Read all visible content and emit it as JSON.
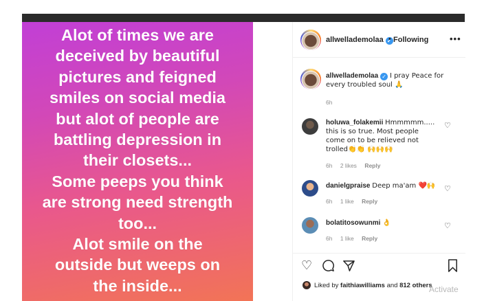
{
  "post_image": {
    "lines": [
      "Alot of times we are",
      "deceived by beautiful",
      "pictures and feigned",
      "smiles on social media",
      "but alot of people are",
      "battling depression in",
      "their closets...",
      "Some peeps you think",
      "are strong need strength",
      "too...",
      "Alot smile on the",
      "outside but weeps on",
      "the inside..."
    ]
  },
  "header": {
    "username": "allwellademоlaa",
    "separator": "•",
    "follow_status": "Following",
    "more": "•••"
  },
  "caption": {
    "username": "allwellademolaa",
    "text": "I pray Peace for every troubled soul 🙏",
    "time": "6h"
  },
  "comments": [
    {
      "username": "holuwa_folakemii",
      "text": "Hmmmmm..... this is so true. Most people come on to be relieved not trolled👏👏 🙌🙌🙌",
      "time": "6h",
      "likes": "2 likes",
      "reply": "Reply"
    },
    {
      "username": "danielgpraise",
      "text": "Deep ma'am ❤️🙌",
      "time": "6h",
      "likes": "1 like",
      "reply": "Reply"
    },
    {
      "username": "bolatitosowunmi",
      "text": "👌",
      "time": "6h",
      "likes": "1 like",
      "reply": "Reply"
    }
  ],
  "actions": {
    "like_icon": "heart-icon",
    "comment_icon": "comment-icon",
    "share_icon": "share-icon",
    "save_icon": "bookmark-icon",
    "liked_by_prefix": "Liked by",
    "liked_by_user": "faithiawilliams",
    "and_text": "and",
    "others": "812 others"
  },
  "watermark": "Activate",
  "colors": {
    "gradient_top": "#c13fd6",
    "gradient_bottom": "#f27456",
    "verified": "#3897f0",
    "text": "#262626",
    "meta": "#8e8e8e"
  }
}
